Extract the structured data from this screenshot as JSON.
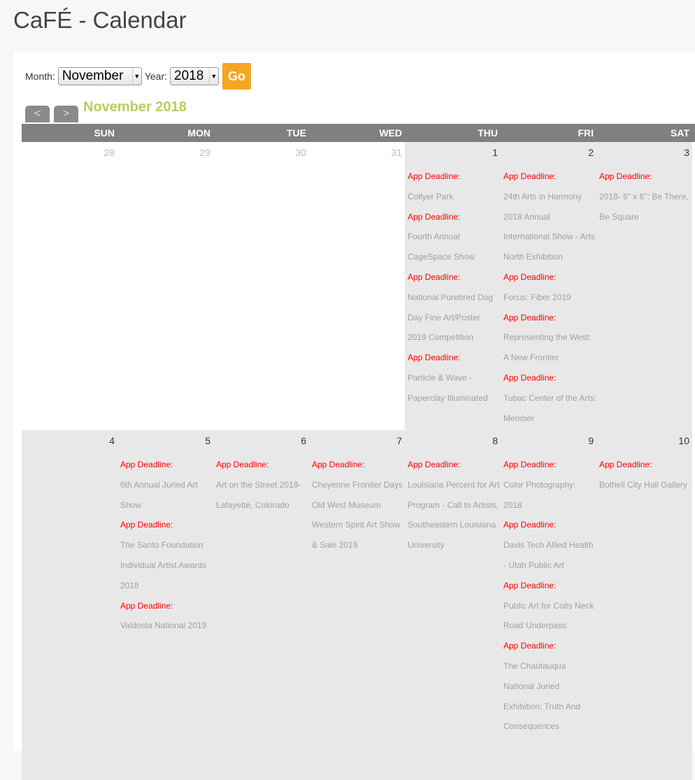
{
  "title": "CaFÉ - Calendar",
  "controls": {
    "month_label": "Month:",
    "month_value": "November",
    "year_label": "Year:",
    "year_value": "2018",
    "go_label": "Go",
    "prev_label": "<",
    "next_label": ">"
  },
  "calendar": {
    "heading": "November 2018",
    "weekdays": [
      "SUN",
      "MON",
      "TUE",
      "WED",
      "THU",
      "FRI",
      "SAT"
    ],
    "event_label": "App Deadline:",
    "weeks": [
      [
        {
          "day": "28",
          "current": false,
          "events": []
        },
        {
          "day": "29",
          "current": false,
          "events": []
        },
        {
          "day": "30",
          "current": false,
          "events": []
        },
        {
          "day": "31",
          "current": false,
          "events": []
        },
        {
          "day": "1",
          "current": true,
          "events": [
            "Collyer Park",
            "Fourth Annual CageSpace Show",
            "National Purebred Dog Day Fine Art/Poster 2019 Competition",
            "Particle & Wave - Paperclay Illuminated"
          ]
        },
        {
          "day": "2",
          "current": true,
          "events": [
            "24th Arts in Harmony 2019 Annual International Show - Arts North Exhibition",
            "Focus: Fiber 2019",
            "Representing the West: A New Frontier",
            "Tubac Center of the Arts: Member"
          ]
        },
        {
          "day": "3",
          "current": true,
          "events": [
            "2018- 6\" x 6\": Be There, Be Square"
          ]
        }
      ],
      [
        {
          "day": "4",
          "current": true,
          "events": []
        },
        {
          "day": "5",
          "current": true,
          "events": [
            "6th Annual Juried Art Show",
            "The Santo Foundation Individual Artist Awards 2018",
            "Valdosta National 2019"
          ]
        },
        {
          "day": "6",
          "current": true,
          "events": [
            "Art on the Street 2019- Lafayette, Colorado"
          ]
        },
        {
          "day": "7",
          "current": true,
          "events": [
            "Cheyenne Frontier Days Old West Museum Western Spirit Art Show & Sale 2019"
          ]
        },
        {
          "day": "8",
          "current": true,
          "events": [
            "Louisiana Percent for Art Program - Call to Artists, Southeastern Louisiana University"
          ]
        },
        {
          "day": "9",
          "current": true,
          "events": [
            "Color Photography: 2018",
            "Davis Tech Allied Health - Utah Public Art",
            "Public Art for Colts Neck Road Underpass",
            "The Chautauqua National Juried Exhibition: Truth And Consequences"
          ]
        },
        {
          "day": "10",
          "current": true,
          "events": [
            "Bothell City Hall Gallery"
          ]
        }
      ]
    ]
  }
}
